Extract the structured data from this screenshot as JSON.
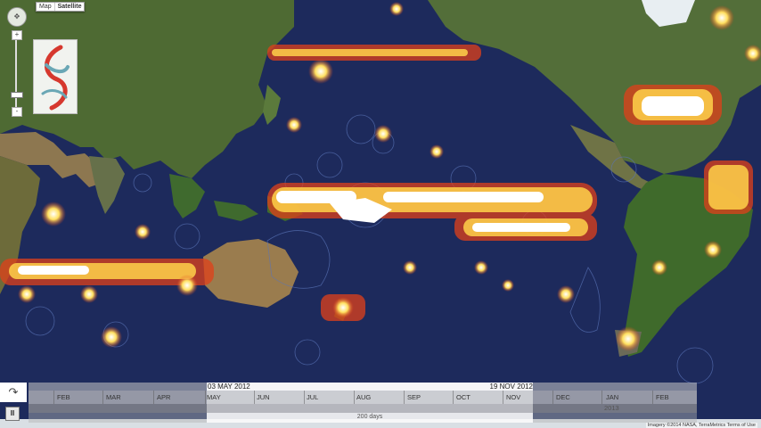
{
  "map": {
    "type_control": {
      "map_label": "Map",
      "satellite_label": "Satellite",
      "active": "Satellite"
    },
    "zoom_in_label": "+",
    "zoom_out_label": "-",
    "attribution": "Imagery ©2014 NASA, TerraMetrics  Terms of Use"
  },
  "timeline": {
    "start_date": "03 MAY 2012",
    "end_date": "19 NOV 2012",
    "duration": "200 days",
    "months": [
      "FEB",
      "MAR",
      "APR",
      "MAY",
      "JUN",
      "JUL",
      "AUG",
      "SEP",
      "OCT",
      "NOV",
      "DEC",
      "JAN",
      "FEB"
    ],
    "year_label": "2013"
  },
  "controls": {
    "share_icon": "share-arrow-icon",
    "pause_icon": "pause-icon",
    "pause_symbol": "II"
  },
  "colors": {
    "ocean": "#1d2a5c",
    "land": "#4a6b2e",
    "desert": "#9a7e50",
    "activity_hot": "#ffffff",
    "activity_warm": "#ffd24a",
    "activity_cool": "#d8421a"
  }
}
